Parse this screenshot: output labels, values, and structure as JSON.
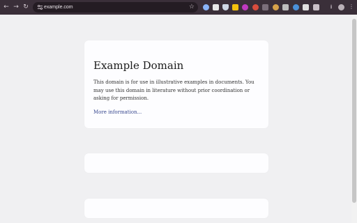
{
  "browser": {
    "url": "example.com",
    "buttons": {
      "back": "←",
      "forward": "→",
      "reload": "↻",
      "star": "☆",
      "downloads": "⭳",
      "menu": "⋮"
    }
  },
  "page": {
    "heading": "Example Domain",
    "body": "This domain is for use in illustrative examples in documents. You may use this domain in literature without prior coordination or asking for permission.",
    "link": "More information..."
  },
  "colors": {
    "chrome": "#3a2f39",
    "omnibox": "#241c23",
    "page_bg": "#f0f0f2",
    "card_bg": "#fdfdff",
    "link": "#38488f"
  }
}
